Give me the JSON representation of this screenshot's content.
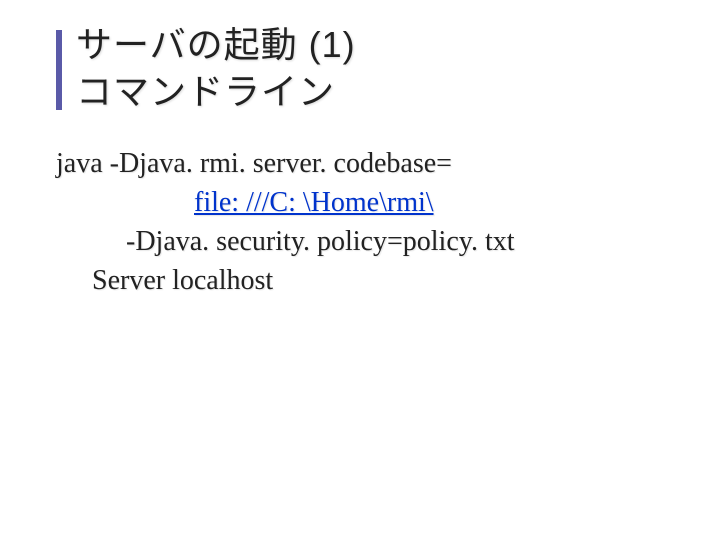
{
  "title": {
    "line1": "サーバの起動 (1)",
    "line2": "コマンドライン"
  },
  "command": {
    "line1": "java -Djava. rmi. server. codebase=",
    "line2_link": "file: ///C: \\Home\\rmi\\",
    "line3": "-Djava. security. policy=policy. txt",
    "line4": "Server localhost"
  }
}
